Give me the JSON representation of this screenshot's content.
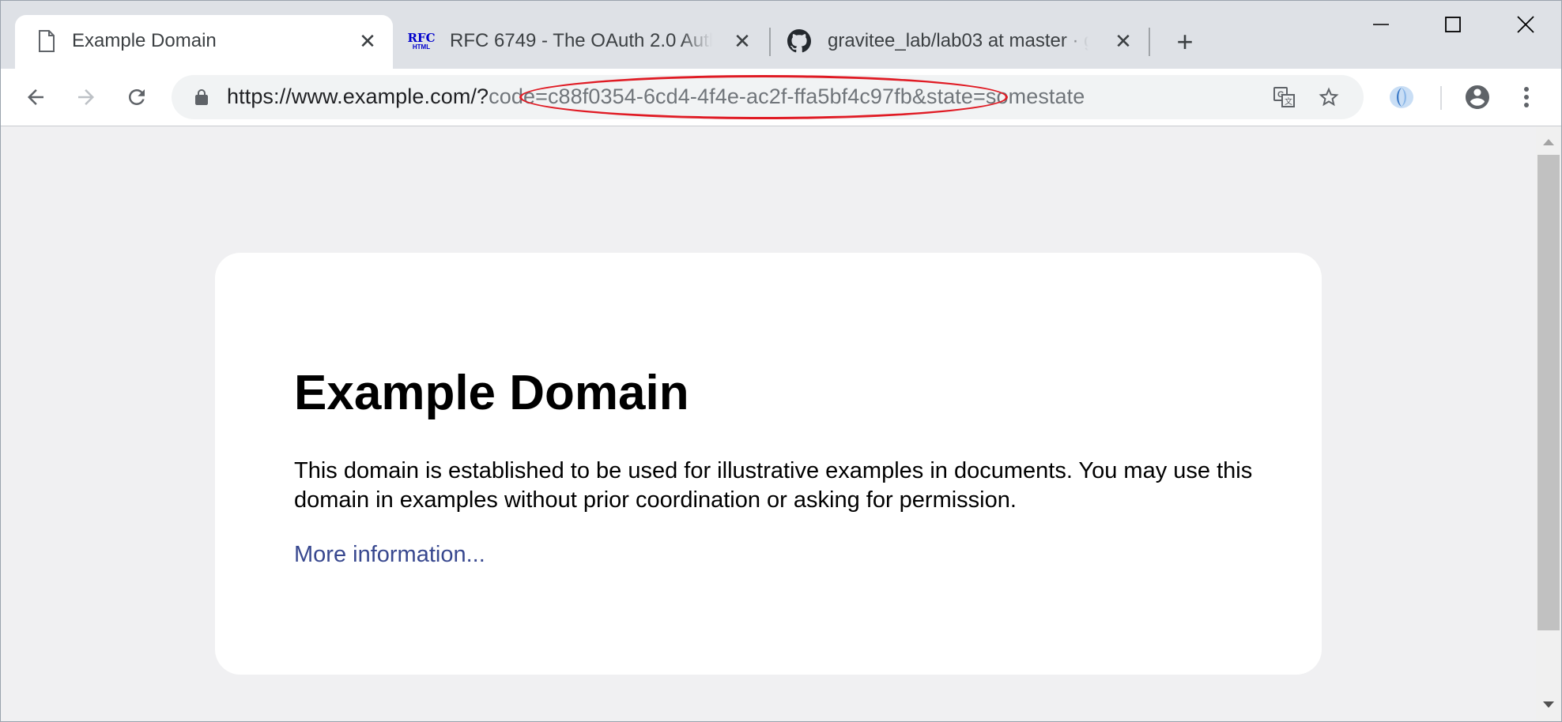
{
  "tabs": [
    {
      "title": "Example Domain",
      "favicon": "document-icon",
      "active": true
    },
    {
      "title": "RFC 6749 - The OAuth 2.0 Auth",
      "favicon": "rfc-html-icon",
      "favicon_text_top": "RFC",
      "favicon_text_bottom": "HTML",
      "active": false
    },
    {
      "title": "gravitee_lab/lab03 at master · g",
      "favicon": "github-icon",
      "active": false
    }
  ],
  "new_tab_label": "+",
  "url": {
    "base": "https://www.example.com/?",
    "query": "code=c88f0354-6cd4-4f4e-ac2f-ffa5bf4c97fb&state=somestate"
  },
  "page": {
    "heading": "Example Domain",
    "description": "This domain is established to be used for illustrative examples in documents. You may use this domain in examples without prior coordination or asking for permission.",
    "link_text": "More information..."
  },
  "colors": {
    "highlight": "#e01b24",
    "link": "#38488f",
    "tabstrip": "#dee1e6",
    "page_bg": "#f0f0f2"
  }
}
